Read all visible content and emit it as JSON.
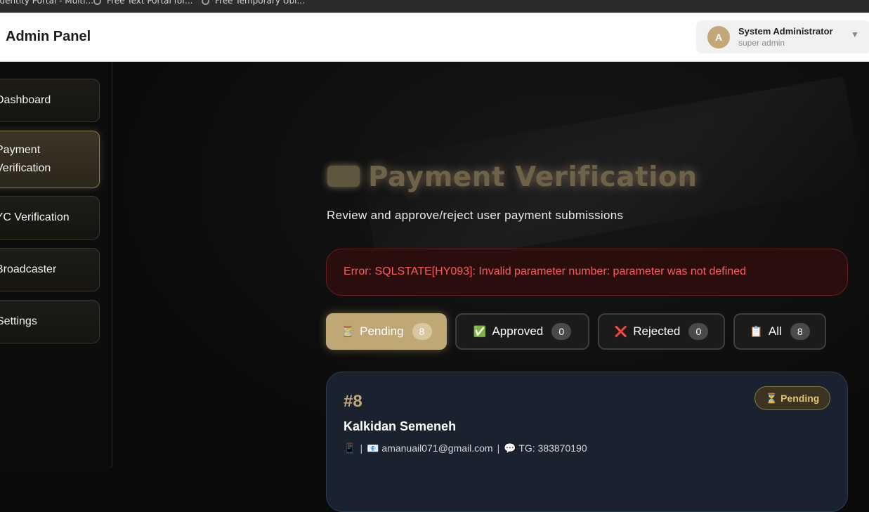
{
  "browser": {
    "bookmarks": [
      "Identity Portal - Multi...",
      "Free Text Portal for...",
      "Free Temporary Ubi..."
    ]
  },
  "header": {
    "title": "Admin Panel",
    "user": {
      "avatar_initial": "A",
      "name": "System Administrator",
      "role": "super admin",
      "caret": "▼"
    }
  },
  "sidebar": {
    "items": [
      {
        "label": "Dashboard"
      },
      {
        "label": "Payment Verification"
      },
      {
        "label": "KYC Verification"
      },
      {
        "label": "Broadcaster"
      },
      {
        "label": "Settings"
      }
    ]
  },
  "main": {
    "title": "Payment Verification",
    "subtitle": "Review and approve/reject user payment submissions",
    "error": "Error: SQLSTATE[HY093]: Invalid parameter number: parameter was not defined",
    "tabs": [
      {
        "icon": "⏳",
        "label": "Pending",
        "count": "8"
      },
      {
        "icon": "✅",
        "label": "Approved",
        "count": "0"
      },
      {
        "icon": "❌",
        "label": "Rejected",
        "count": "0"
      },
      {
        "icon": "📋",
        "label": "All",
        "count": "8"
      }
    ],
    "card": {
      "id": "#8",
      "name": "Kalkidan Semeneh",
      "phone_icon": "📱",
      "email_icon": "📧",
      "email": "amanuail071@gmail.com",
      "tg_icon": "💬",
      "tg": "TG: 383870190",
      "status_icon": "⏳",
      "status": "Pending"
    }
  },
  "colors": {
    "accent": "#c2a878",
    "error": "#ff5a5a",
    "pending": "#e8c46a"
  }
}
